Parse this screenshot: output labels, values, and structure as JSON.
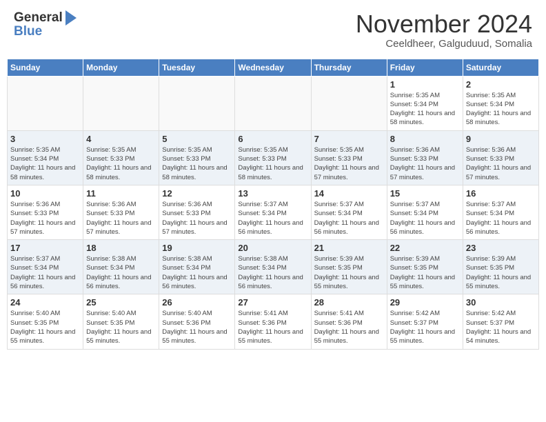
{
  "header": {
    "logo_line1": "General",
    "logo_line2": "Blue",
    "month": "November 2024",
    "location": "Ceeldheer, Galguduud, Somalia"
  },
  "days_of_week": [
    "Sunday",
    "Monday",
    "Tuesday",
    "Wednesday",
    "Thursday",
    "Friday",
    "Saturday"
  ],
  "weeks": [
    [
      {
        "day": "",
        "sunrise": "",
        "sunset": "",
        "daylight": ""
      },
      {
        "day": "",
        "sunrise": "",
        "sunset": "",
        "daylight": ""
      },
      {
        "day": "",
        "sunrise": "",
        "sunset": "",
        "daylight": ""
      },
      {
        "day": "",
        "sunrise": "",
        "sunset": "",
        "daylight": ""
      },
      {
        "day": "",
        "sunrise": "",
        "sunset": "",
        "daylight": ""
      },
      {
        "day": "1",
        "sunrise": "Sunrise: 5:35 AM",
        "sunset": "Sunset: 5:34 PM",
        "daylight": "Daylight: 11 hours and 58 minutes."
      },
      {
        "day": "2",
        "sunrise": "Sunrise: 5:35 AM",
        "sunset": "Sunset: 5:34 PM",
        "daylight": "Daylight: 11 hours and 58 minutes."
      }
    ],
    [
      {
        "day": "3",
        "sunrise": "Sunrise: 5:35 AM",
        "sunset": "Sunset: 5:34 PM",
        "daylight": "Daylight: 11 hours and 58 minutes."
      },
      {
        "day": "4",
        "sunrise": "Sunrise: 5:35 AM",
        "sunset": "Sunset: 5:33 PM",
        "daylight": "Daylight: 11 hours and 58 minutes."
      },
      {
        "day": "5",
        "sunrise": "Sunrise: 5:35 AM",
        "sunset": "Sunset: 5:33 PM",
        "daylight": "Daylight: 11 hours and 58 minutes."
      },
      {
        "day": "6",
        "sunrise": "Sunrise: 5:35 AM",
        "sunset": "Sunset: 5:33 PM",
        "daylight": "Daylight: 11 hours and 58 minutes."
      },
      {
        "day": "7",
        "sunrise": "Sunrise: 5:35 AM",
        "sunset": "Sunset: 5:33 PM",
        "daylight": "Daylight: 11 hours and 57 minutes."
      },
      {
        "day": "8",
        "sunrise": "Sunrise: 5:36 AM",
        "sunset": "Sunset: 5:33 PM",
        "daylight": "Daylight: 11 hours and 57 minutes."
      },
      {
        "day": "9",
        "sunrise": "Sunrise: 5:36 AM",
        "sunset": "Sunset: 5:33 PM",
        "daylight": "Daylight: 11 hours and 57 minutes."
      }
    ],
    [
      {
        "day": "10",
        "sunrise": "Sunrise: 5:36 AM",
        "sunset": "Sunset: 5:33 PM",
        "daylight": "Daylight: 11 hours and 57 minutes."
      },
      {
        "day": "11",
        "sunrise": "Sunrise: 5:36 AM",
        "sunset": "Sunset: 5:33 PM",
        "daylight": "Daylight: 11 hours and 57 minutes."
      },
      {
        "day": "12",
        "sunrise": "Sunrise: 5:36 AM",
        "sunset": "Sunset: 5:33 PM",
        "daylight": "Daylight: 11 hours and 57 minutes."
      },
      {
        "day": "13",
        "sunrise": "Sunrise: 5:37 AM",
        "sunset": "Sunset: 5:34 PM",
        "daylight": "Daylight: 11 hours and 56 minutes."
      },
      {
        "day": "14",
        "sunrise": "Sunrise: 5:37 AM",
        "sunset": "Sunset: 5:34 PM",
        "daylight": "Daylight: 11 hours and 56 minutes."
      },
      {
        "day": "15",
        "sunrise": "Sunrise: 5:37 AM",
        "sunset": "Sunset: 5:34 PM",
        "daylight": "Daylight: 11 hours and 56 minutes."
      },
      {
        "day": "16",
        "sunrise": "Sunrise: 5:37 AM",
        "sunset": "Sunset: 5:34 PM",
        "daylight": "Daylight: 11 hours and 56 minutes."
      }
    ],
    [
      {
        "day": "17",
        "sunrise": "Sunrise: 5:37 AM",
        "sunset": "Sunset: 5:34 PM",
        "daylight": "Daylight: 11 hours and 56 minutes."
      },
      {
        "day": "18",
        "sunrise": "Sunrise: 5:38 AM",
        "sunset": "Sunset: 5:34 PM",
        "daylight": "Daylight: 11 hours and 56 minutes."
      },
      {
        "day": "19",
        "sunrise": "Sunrise: 5:38 AM",
        "sunset": "Sunset: 5:34 PM",
        "daylight": "Daylight: 11 hours and 56 minutes."
      },
      {
        "day": "20",
        "sunrise": "Sunrise: 5:38 AM",
        "sunset": "Sunset: 5:34 PM",
        "daylight": "Daylight: 11 hours and 56 minutes."
      },
      {
        "day": "21",
        "sunrise": "Sunrise: 5:39 AM",
        "sunset": "Sunset: 5:35 PM",
        "daylight": "Daylight: 11 hours and 55 minutes."
      },
      {
        "day": "22",
        "sunrise": "Sunrise: 5:39 AM",
        "sunset": "Sunset: 5:35 PM",
        "daylight": "Daylight: 11 hours and 55 minutes."
      },
      {
        "day": "23",
        "sunrise": "Sunrise: 5:39 AM",
        "sunset": "Sunset: 5:35 PM",
        "daylight": "Daylight: 11 hours and 55 minutes."
      }
    ],
    [
      {
        "day": "24",
        "sunrise": "Sunrise: 5:40 AM",
        "sunset": "Sunset: 5:35 PM",
        "daylight": "Daylight: 11 hours and 55 minutes."
      },
      {
        "day": "25",
        "sunrise": "Sunrise: 5:40 AM",
        "sunset": "Sunset: 5:35 PM",
        "daylight": "Daylight: 11 hours and 55 minutes."
      },
      {
        "day": "26",
        "sunrise": "Sunrise: 5:40 AM",
        "sunset": "Sunset: 5:36 PM",
        "daylight": "Daylight: 11 hours and 55 minutes."
      },
      {
        "day": "27",
        "sunrise": "Sunrise: 5:41 AM",
        "sunset": "Sunset: 5:36 PM",
        "daylight": "Daylight: 11 hours and 55 minutes."
      },
      {
        "day": "28",
        "sunrise": "Sunrise: 5:41 AM",
        "sunset": "Sunset: 5:36 PM",
        "daylight": "Daylight: 11 hours and 55 minutes."
      },
      {
        "day": "29",
        "sunrise": "Sunrise: 5:42 AM",
        "sunset": "Sunset: 5:37 PM",
        "daylight": "Daylight: 11 hours and 55 minutes."
      },
      {
        "day": "30",
        "sunrise": "Sunrise: 5:42 AM",
        "sunset": "Sunset: 5:37 PM",
        "daylight": "Daylight: 11 hours and 54 minutes."
      }
    ]
  ]
}
